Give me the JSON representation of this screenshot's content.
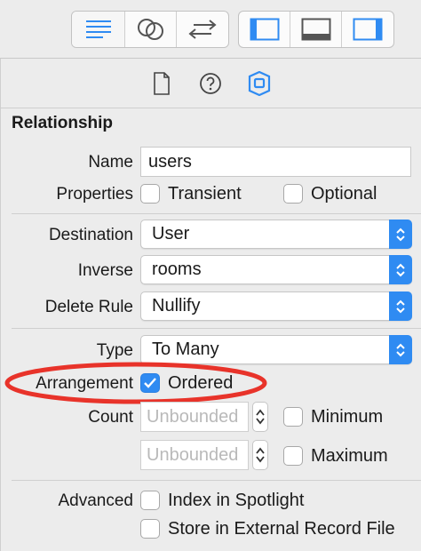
{
  "inspector": {
    "section_title": "Relationship",
    "name": {
      "label": "Name",
      "value": "users"
    },
    "properties": {
      "label": "Properties",
      "transient": {
        "label": "Transient",
        "checked": false
      },
      "optional": {
        "label": "Optional",
        "checked": false
      }
    },
    "destination": {
      "label": "Destination",
      "value": "User"
    },
    "inverse": {
      "label": "Inverse",
      "value": "rooms"
    },
    "delete_rule": {
      "label": "Delete Rule",
      "value": "Nullify"
    },
    "type": {
      "label": "Type",
      "value": "To Many"
    },
    "arrangement": {
      "label": "Arrangement",
      "ordered": {
        "label": "Ordered",
        "checked": true
      }
    },
    "count": {
      "label": "Count",
      "minimum": {
        "placeholder": "Unbounded",
        "label": "Minimum",
        "checked": false
      },
      "maximum": {
        "placeholder": "Unbounded",
        "label": "Maximum",
        "checked": false
      }
    },
    "advanced": {
      "label": "Advanced",
      "index_in_spotlight": {
        "label": "Index in Spotlight",
        "checked": false
      },
      "store_external": {
        "label": "Store in External Record File",
        "checked": false
      }
    }
  },
  "toolbar": {
    "editor_icons": [
      "text-align-icon",
      "linked-circles-icon",
      "swap-arrows-icon"
    ],
    "panel_icons": [
      "left-panel-icon",
      "bottom-panel-icon",
      "right-panel-icon"
    ]
  },
  "inspector_tabs": [
    "file-icon",
    "help-icon",
    "data-model-icon"
  ],
  "annotation": {
    "color": "#e8332a"
  },
  "colors": {
    "accent": "#2f8bf2",
    "background": "#ececec"
  }
}
